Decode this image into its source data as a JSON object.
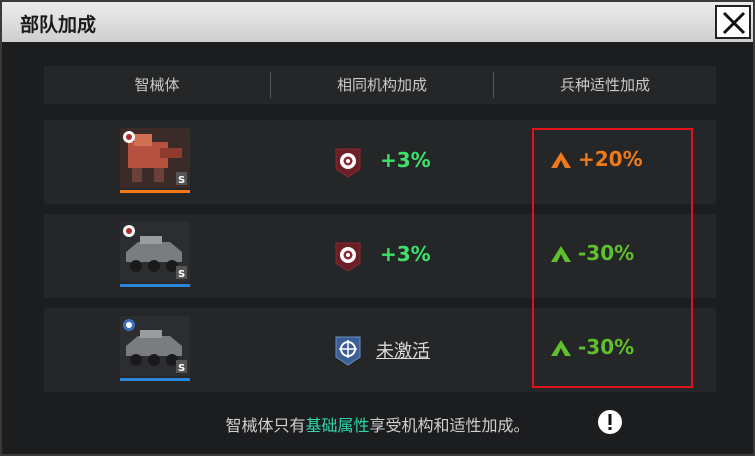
{
  "dialog": {
    "title": "部队加成",
    "close_label": "close"
  },
  "table": {
    "headers": [
      "智械体",
      "相同机构加成",
      "兵种适性加成"
    ],
    "rows": [
      {
        "unit_icon": "red-mech-unit-icon",
        "org_icon": "red-org-emblem-icon",
        "org_bonus": "+3%",
        "type_bonus": "+20%",
        "type_color": "#f07a1a",
        "bar_color": "#f07a1a",
        "level": "S"
      },
      {
        "unit_icon": "armored-vehicle-icon",
        "org_icon": "red-org-emblem-icon",
        "org_bonus": "+3%",
        "type_bonus": "-30%",
        "type_color": "#5fbf2c",
        "bar_color": "#2a86d8",
        "level": "S"
      },
      {
        "unit_icon": "armored-vehicle-icon",
        "org_icon": "blue-org-emblem-icon",
        "org_bonus": "未激活",
        "type_bonus": "-30%",
        "type_color": "#5fbf2c",
        "bar_color": "#2a86d8",
        "level": "S"
      }
    ]
  },
  "footer": {
    "prefix": "智械体只有",
    "highlight": "基础属性",
    "suffix": "享受机构和适性加成。"
  },
  "colors": {
    "bonus_green": "#3fe06a",
    "highlight_teal": "#2fd7ad",
    "outline_red": "#e0121b"
  }
}
